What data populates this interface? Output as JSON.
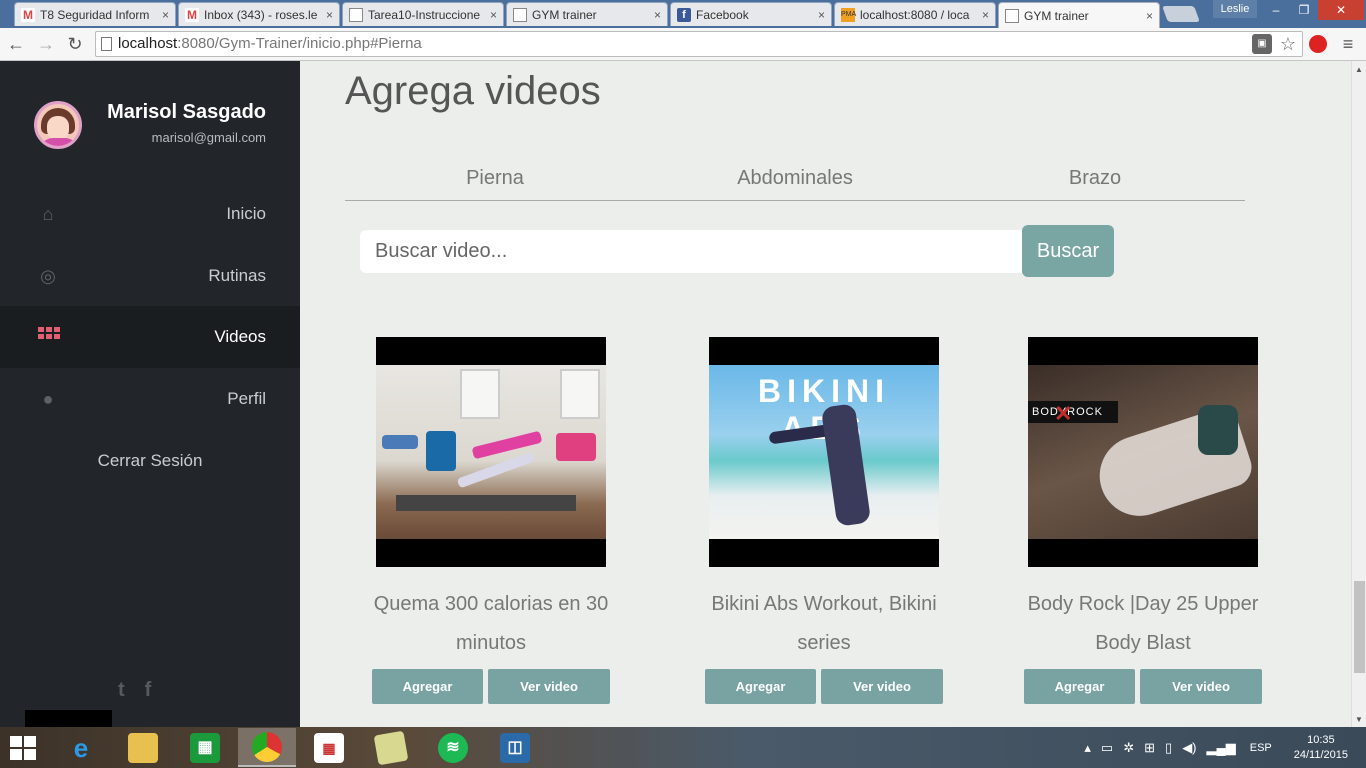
{
  "browser": {
    "tabs": [
      {
        "label": "T8 Seguridad Inform",
        "favicon": "gmail-icon",
        "close": "×"
      },
      {
        "label": "Inbox (343) - roses.le",
        "favicon": "gmail-icon",
        "close": "×"
      },
      {
        "label": "Tarea10-Instruccione",
        "favicon": "document-icon",
        "close": "×"
      },
      {
        "label": "GYM trainer",
        "favicon": "document-icon",
        "close": "×"
      },
      {
        "label": "Facebook",
        "favicon": "facebook-icon",
        "close": "×"
      },
      {
        "label": "localhost:8080 / loca",
        "favicon": "phpmyadmin-icon",
        "close": "×"
      },
      {
        "label": "GYM trainer",
        "favicon": "document-icon",
        "close": "×"
      }
    ],
    "profile_name": "Leslie",
    "url_host": "localhost",
    "url_path": ":8080/Gym-Trainer/inicio.php#Pierna",
    "glyphs": {
      "back": "←",
      "forward": "→",
      "reload": "↻",
      "star": "☆",
      "menu": "≡",
      "minimize": "–",
      "maximize": "❐",
      "close": "✕"
    }
  },
  "sidebar": {
    "user_name": "Marisol Sasgado",
    "user_email": "marisol@gmail.com",
    "menu": [
      {
        "label": "Inicio",
        "icon": "home-icon",
        "glyph": "⌂"
      },
      {
        "label": "Rutinas",
        "icon": "dribbble-icon",
        "glyph": "◎"
      },
      {
        "label": "Videos",
        "icon": "grid-icon",
        "active": true
      },
      {
        "label": "Perfil",
        "icon": "user-icon",
        "glyph": "●"
      }
    ],
    "logout_label": "Cerrar Sesión",
    "social": {
      "twitter": "t",
      "facebook": "f"
    }
  },
  "main": {
    "title": "Agrega videos",
    "categories": [
      "Pierna",
      "Abdominales",
      "Brazo"
    ],
    "search": {
      "placeholder": "Buscar video...",
      "button_label": "Buscar"
    },
    "videos": [
      {
        "title": "Quema 300 calorias en 30 minutos",
        "add_label": "Agregar",
        "view_label": "Ver video"
      },
      {
        "title": "Bikini Abs Workout, Bikini series",
        "add_label": "Agregar",
        "view_label": "Ver video",
        "thumb_text": "BIKINI ABS"
      },
      {
        "title": "Body Rock |Day 25 Upper Body Blast",
        "add_label": "Agregar",
        "view_label": "Ver video",
        "thumb_text": "BODYROCK"
      }
    ]
  },
  "taskbar": {
    "apps": [
      "internet-explorer-icon",
      "file-explorer-icon",
      "store-icon",
      "chrome-icon",
      "apps-icon",
      "notes-icon",
      "spotify-icon",
      "stack-icon"
    ],
    "language": "ESP",
    "time": "10:35",
    "date": "24/11/2015"
  },
  "colors": {
    "sidebar_bg": "#22262a",
    "accent": "#79a5a3",
    "active_icon": "#e06072"
  }
}
